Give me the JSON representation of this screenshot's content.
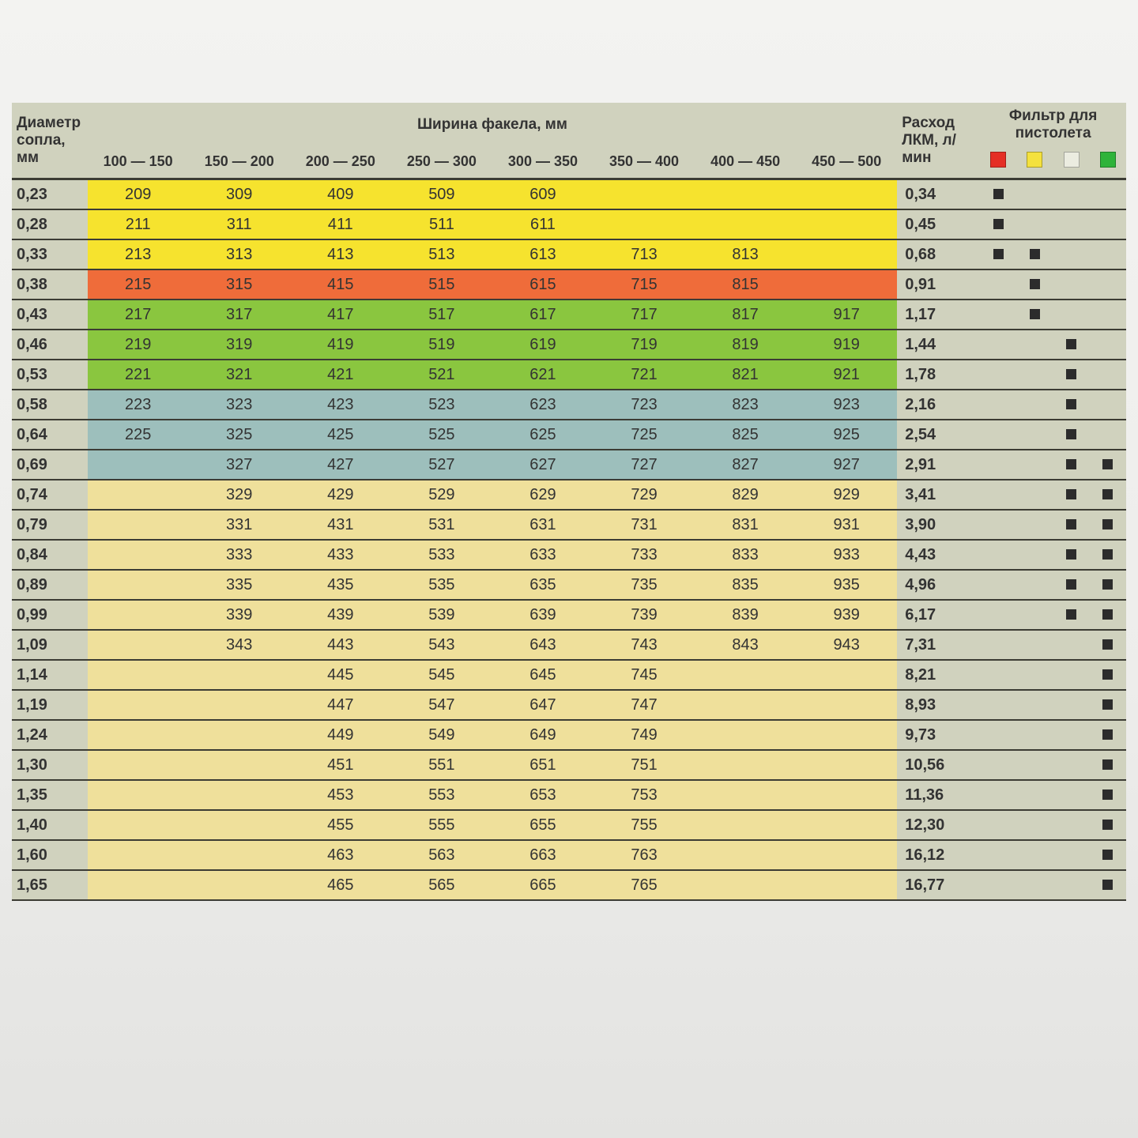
{
  "headers": {
    "diameter": "Диаметр сопла, мм",
    "fan_width": "Ширина факела, мм",
    "flow": "Расход ЛКМ, л/мин",
    "filter": "Фильтр для пистолета",
    "ranges": [
      "100 — 150",
      "150 — 200",
      "200 — 250",
      "250 — 300",
      "300 — 350",
      "350 — 400",
      "400 — 450",
      "450 — 500"
    ]
  },
  "filter_colors": [
    "red",
    "yellow",
    "white",
    "green"
  ],
  "row_colors": {
    "yellow": "#f6e32e",
    "orange": "#ef6c3a",
    "green": "#8ac63f",
    "blue": "#9dbfbc",
    "pale": "#efe09b",
    "none": "#d0d2be"
  },
  "chart_data": {
    "type": "table",
    "columns": [
      "Диаметр сопла, мм",
      "100 — 150",
      "150 — 200",
      "200 — 250",
      "250 — 300",
      "300 — 350",
      "350 — 400",
      "400 — 450",
      "450 — 500",
      "Расход ЛКМ, л/мин",
      "filter_red",
      "filter_yellow",
      "filter_white",
      "filter_green"
    ],
    "rows": [
      {
        "d": "0,23",
        "c": "yellow",
        "v": [
          "209",
          "309",
          "409",
          "509",
          "609",
          "",
          "",
          ""
        ],
        "flow": "0,34",
        "f": [
          1,
          0,
          0,
          0
        ]
      },
      {
        "d": "0,28",
        "c": "yellow",
        "v": [
          "211",
          "311",
          "411",
          "511",
          "611",
          "",
          "",
          ""
        ],
        "flow": "0,45",
        "f": [
          1,
          0,
          0,
          0
        ]
      },
      {
        "d": "0,33",
        "c": "yellow",
        "v": [
          "213",
          "313",
          "413",
          "513",
          "613",
          "713",
          "813",
          ""
        ],
        "flow": "0,68",
        "f": [
          1,
          1,
          0,
          0
        ]
      },
      {
        "d": "0,38",
        "c": "orange",
        "v": [
          "215",
          "315",
          "415",
          "515",
          "615",
          "715",
          "815",
          ""
        ],
        "flow": "0,91",
        "f": [
          0,
          1,
          0,
          0
        ]
      },
      {
        "d": "0,43",
        "c": "green",
        "v": [
          "217",
          "317",
          "417",
          "517",
          "617",
          "717",
          "817",
          "917"
        ],
        "flow": "1,17",
        "f": [
          0,
          1,
          0,
          0
        ]
      },
      {
        "d": "0,46",
        "c": "green",
        "v": [
          "219",
          "319",
          "419",
          "519",
          "619",
          "719",
          "819",
          "919"
        ],
        "flow": "1,44",
        "f": [
          0,
          0,
          1,
          0
        ]
      },
      {
        "d": "0,53",
        "c": "green",
        "v": [
          "221",
          "321",
          "421",
          "521",
          "621",
          "721",
          "821",
          "921"
        ],
        "flow": "1,78",
        "f": [
          0,
          0,
          1,
          0
        ]
      },
      {
        "d": "0,58",
        "c": "blue",
        "v": [
          "223",
          "323",
          "423",
          "523",
          "623",
          "723",
          "823",
          "923"
        ],
        "flow": "2,16",
        "f": [
          0,
          0,
          1,
          0
        ]
      },
      {
        "d": "0,64",
        "c": "blue",
        "v": [
          "225",
          "325",
          "425",
          "525",
          "625",
          "725",
          "825",
          "925"
        ],
        "flow": "2,54",
        "f": [
          0,
          0,
          1,
          0
        ]
      },
      {
        "d": "0,69",
        "c": "blue",
        "v": [
          "",
          "327",
          "427",
          "527",
          "627",
          "727",
          "827",
          "927"
        ],
        "flow": "2,91",
        "f": [
          0,
          0,
          1,
          1
        ]
      },
      {
        "d": "0,74",
        "c": "pale",
        "v": [
          "",
          "329",
          "429",
          "529",
          "629",
          "729",
          "829",
          "929"
        ],
        "flow": "3,41",
        "f": [
          0,
          0,
          1,
          1
        ]
      },
      {
        "d": "0,79",
        "c": "pale",
        "v": [
          "",
          "331",
          "431",
          "531",
          "631",
          "731",
          "831",
          "931"
        ],
        "flow": "3,90",
        "f": [
          0,
          0,
          1,
          1
        ]
      },
      {
        "d": "0,84",
        "c": "pale",
        "v": [
          "",
          "333",
          "433",
          "533",
          "633",
          "733",
          "833",
          "933"
        ],
        "flow": "4,43",
        "f": [
          0,
          0,
          1,
          1
        ]
      },
      {
        "d": "0,89",
        "c": "pale",
        "v": [
          "",
          "335",
          "435",
          "535",
          "635",
          "735",
          "835",
          "935"
        ],
        "flow": "4,96",
        "f": [
          0,
          0,
          1,
          1
        ]
      },
      {
        "d": "0,99",
        "c": "pale",
        "v": [
          "",
          "339",
          "439",
          "539",
          "639",
          "739",
          "839",
          "939"
        ],
        "flow": "6,17",
        "f": [
          0,
          0,
          1,
          1
        ]
      },
      {
        "d": "1,09",
        "c": "pale",
        "v": [
          "",
          "343",
          "443",
          "543",
          "643",
          "743",
          "843",
          "943"
        ],
        "flow": "7,31",
        "f": [
          0,
          0,
          0,
          1
        ]
      },
      {
        "d": "1,14",
        "c": "pale",
        "v": [
          "",
          "",
          "445",
          "545",
          "645",
          "745",
          "",
          ""
        ],
        "flow": "8,21",
        "f": [
          0,
          0,
          0,
          1
        ]
      },
      {
        "d": "1,19",
        "c": "pale",
        "v": [
          "",
          "",
          "447",
          "547",
          "647",
          "747",
          "",
          ""
        ],
        "flow": "8,93",
        "f": [
          0,
          0,
          0,
          1
        ]
      },
      {
        "d": "1,24",
        "c": "pale",
        "v": [
          "",
          "",
          "449",
          "549",
          "649",
          "749",
          "",
          ""
        ],
        "flow": "9,73",
        "f": [
          0,
          0,
          0,
          1
        ]
      },
      {
        "d": "1,30",
        "c": "pale",
        "v": [
          "",
          "",
          "451",
          "551",
          "651",
          "751",
          "",
          ""
        ],
        "flow": "10,56",
        "f": [
          0,
          0,
          0,
          1
        ]
      },
      {
        "d": "1,35",
        "c": "pale",
        "v": [
          "",
          "",
          "453",
          "553",
          "653",
          "753",
          "",
          ""
        ],
        "flow": "11,36",
        "f": [
          0,
          0,
          0,
          1
        ]
      },
      {
        "d": "1,40",
        "c": "pale",
        "v": [
          "",
          "",
          "455",
          "555",
          "655",
          "755",
          "",
          ""
        ],
        "flow": "12,30",
        "f": [
          0,
          0,
          0,
          1
        ]
      },
      {
        "d": "1,60",
        "c": "pale",
        "v": [
          "",
          "",
          "463",
          "563",
          "663",
          "763",
          "",
          ""
        ],
        "flow": "16,12",
        "f": [
          0,
          0,
          0,
          1
        ]
      },
      {
        "d": "1,65",
        "c": "pale",
        "v": [
          "",
          "",
          "465",
          "565",
          "665",
          "765",
          "",
          ""
        ],
        "flow": "16,77",
        "f": [
          0,
          0,
          0,
          1
        ]
      }
    ]
  }
}
